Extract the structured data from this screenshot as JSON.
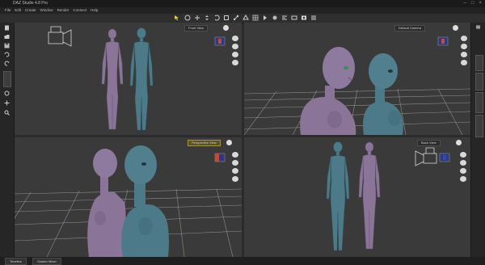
{
  "window": {
    "title": "DAZ Studio 4.8 Pro"
  },
  "menu": [
    "File",
    "Edit",
    "Create",
    "Window",
    "Render",
    "Connect",
    "Help"
  ],
  "viewports": {
    "top_left": {
      "camera": "Front View"
    },
    "top_right": {
      "camera": "Default Camera"
    },
    "bottom_left": {
      "camera": "Perspective View"
    },
    "bottom_right": {
      "camera": "Back View"
    }
  },
  "bottom_tabs": [
    "Timeline",
    "Shader Mixer"
  ],
  "colors": {
    "figure_purple": "#8a7498",
    "figure_teal": "#4c7a88",
    "active_label": "#a39540"
  },
  "icons": {
    "cube_front": "view-cube-front-icon",
    "cube_back": "view-cube-back-icon",
    "camera": "camera-icon"
  }
}
